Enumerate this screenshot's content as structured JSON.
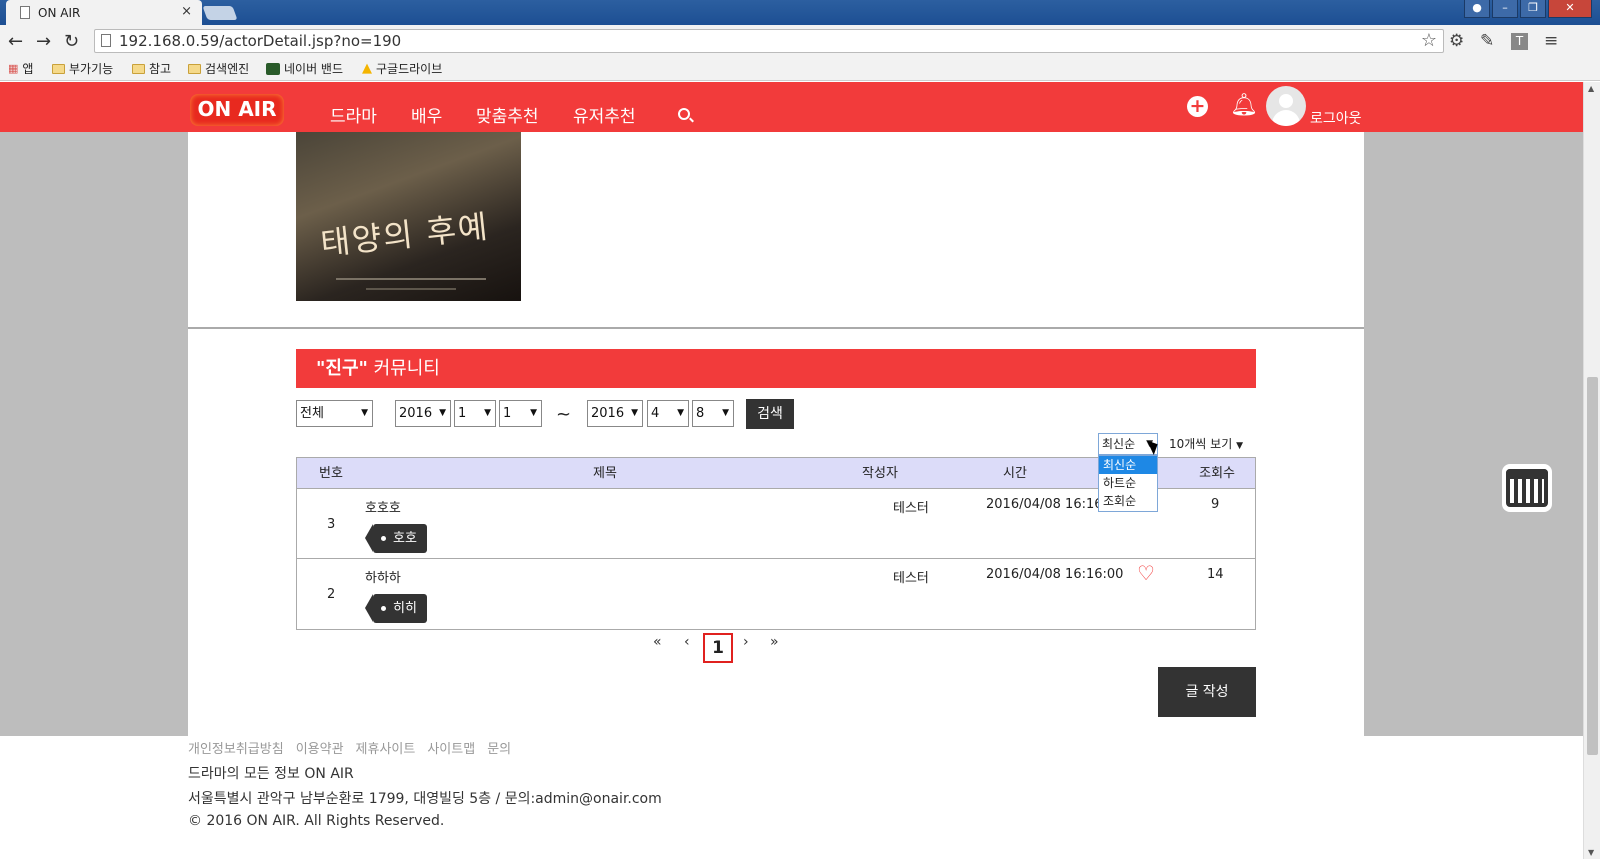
{
  "browser": {
    "tab_title": "ON AIR",
    "tab_close": "×",
    "url": "192.168.0.59/actorDetail.jsp?no=190",
    "bookmarks": [
      "앱",
      "부가기능",
      "참고",
      "검색엔진",
      "네이버 밴드",
      "구글드라이브"
    ]
  },
  "header": {
    "logo": "ON AIR",
    "menu": [
      "드라마",
      "배우",
      "맞춤추천",
      "유저추천"
    ],
    "logout": "로그아웃"
  },
  "community": {
    "title_quoted": "\"진구\"",
    "title_suffix": " 커뮤니티",
    "filter_category": "전체",
    "start_year": "2016",
    "start_month": "1",
    "start_day": "1",
    "tilde": "~",
    "end_year": "2016",
    "end_month": "4",
    "end_day": "8",
    "search_button": "검색",
    "sort_selected": "최신순",
    "sort_options": [
      "최신순",
      "하트순",
      "조회순"
    ],
    "per_page": "10개씩 보기",
    "columns": [
      "번호",
      "제목",
      "작성자",
      "시간",
      "조회수"
    ],
    "rows": [
      {
        "no": "3",
        "title": "호호호",
        "tag": "호호",
        "author": "테스터",
        "time": "2016/04/08 16:16:",
        "views": "9"
      },
      {
        "no": "2",
        "title": "하하하",
        "tag": "히히",
        "author": "테스터",
        "time": "2016/04/08 16:16:00",
        "views": "14"
      }
    ],
    "pager": {
      "first": "«",
      "prev": "‹",
      "current": "1",
      "next": "›",
      "last": "»"
    },
    "write_button": "글 작성"
  },
  "footer": {
    "links": [
      "개인정보취급방침",
      "이용약관",
      "제휴사이트",
      "사이트맵",
      "문의"
    ],
    "line1": "드라마의 모든 정보 ON AIR",
    "line2": "서울특별시 관악구 남부순환로 1799, 대영빌딩 5층 / 문의:admin@onair.com",
    "line3": "© 2016 ON AIR. All Rights Reserved."
  },
  "colors": {
    "brand_red": "#f23b3b",
    "header_row": "#dcdcf9",
    "dark_button": "#333333"
  }
}
